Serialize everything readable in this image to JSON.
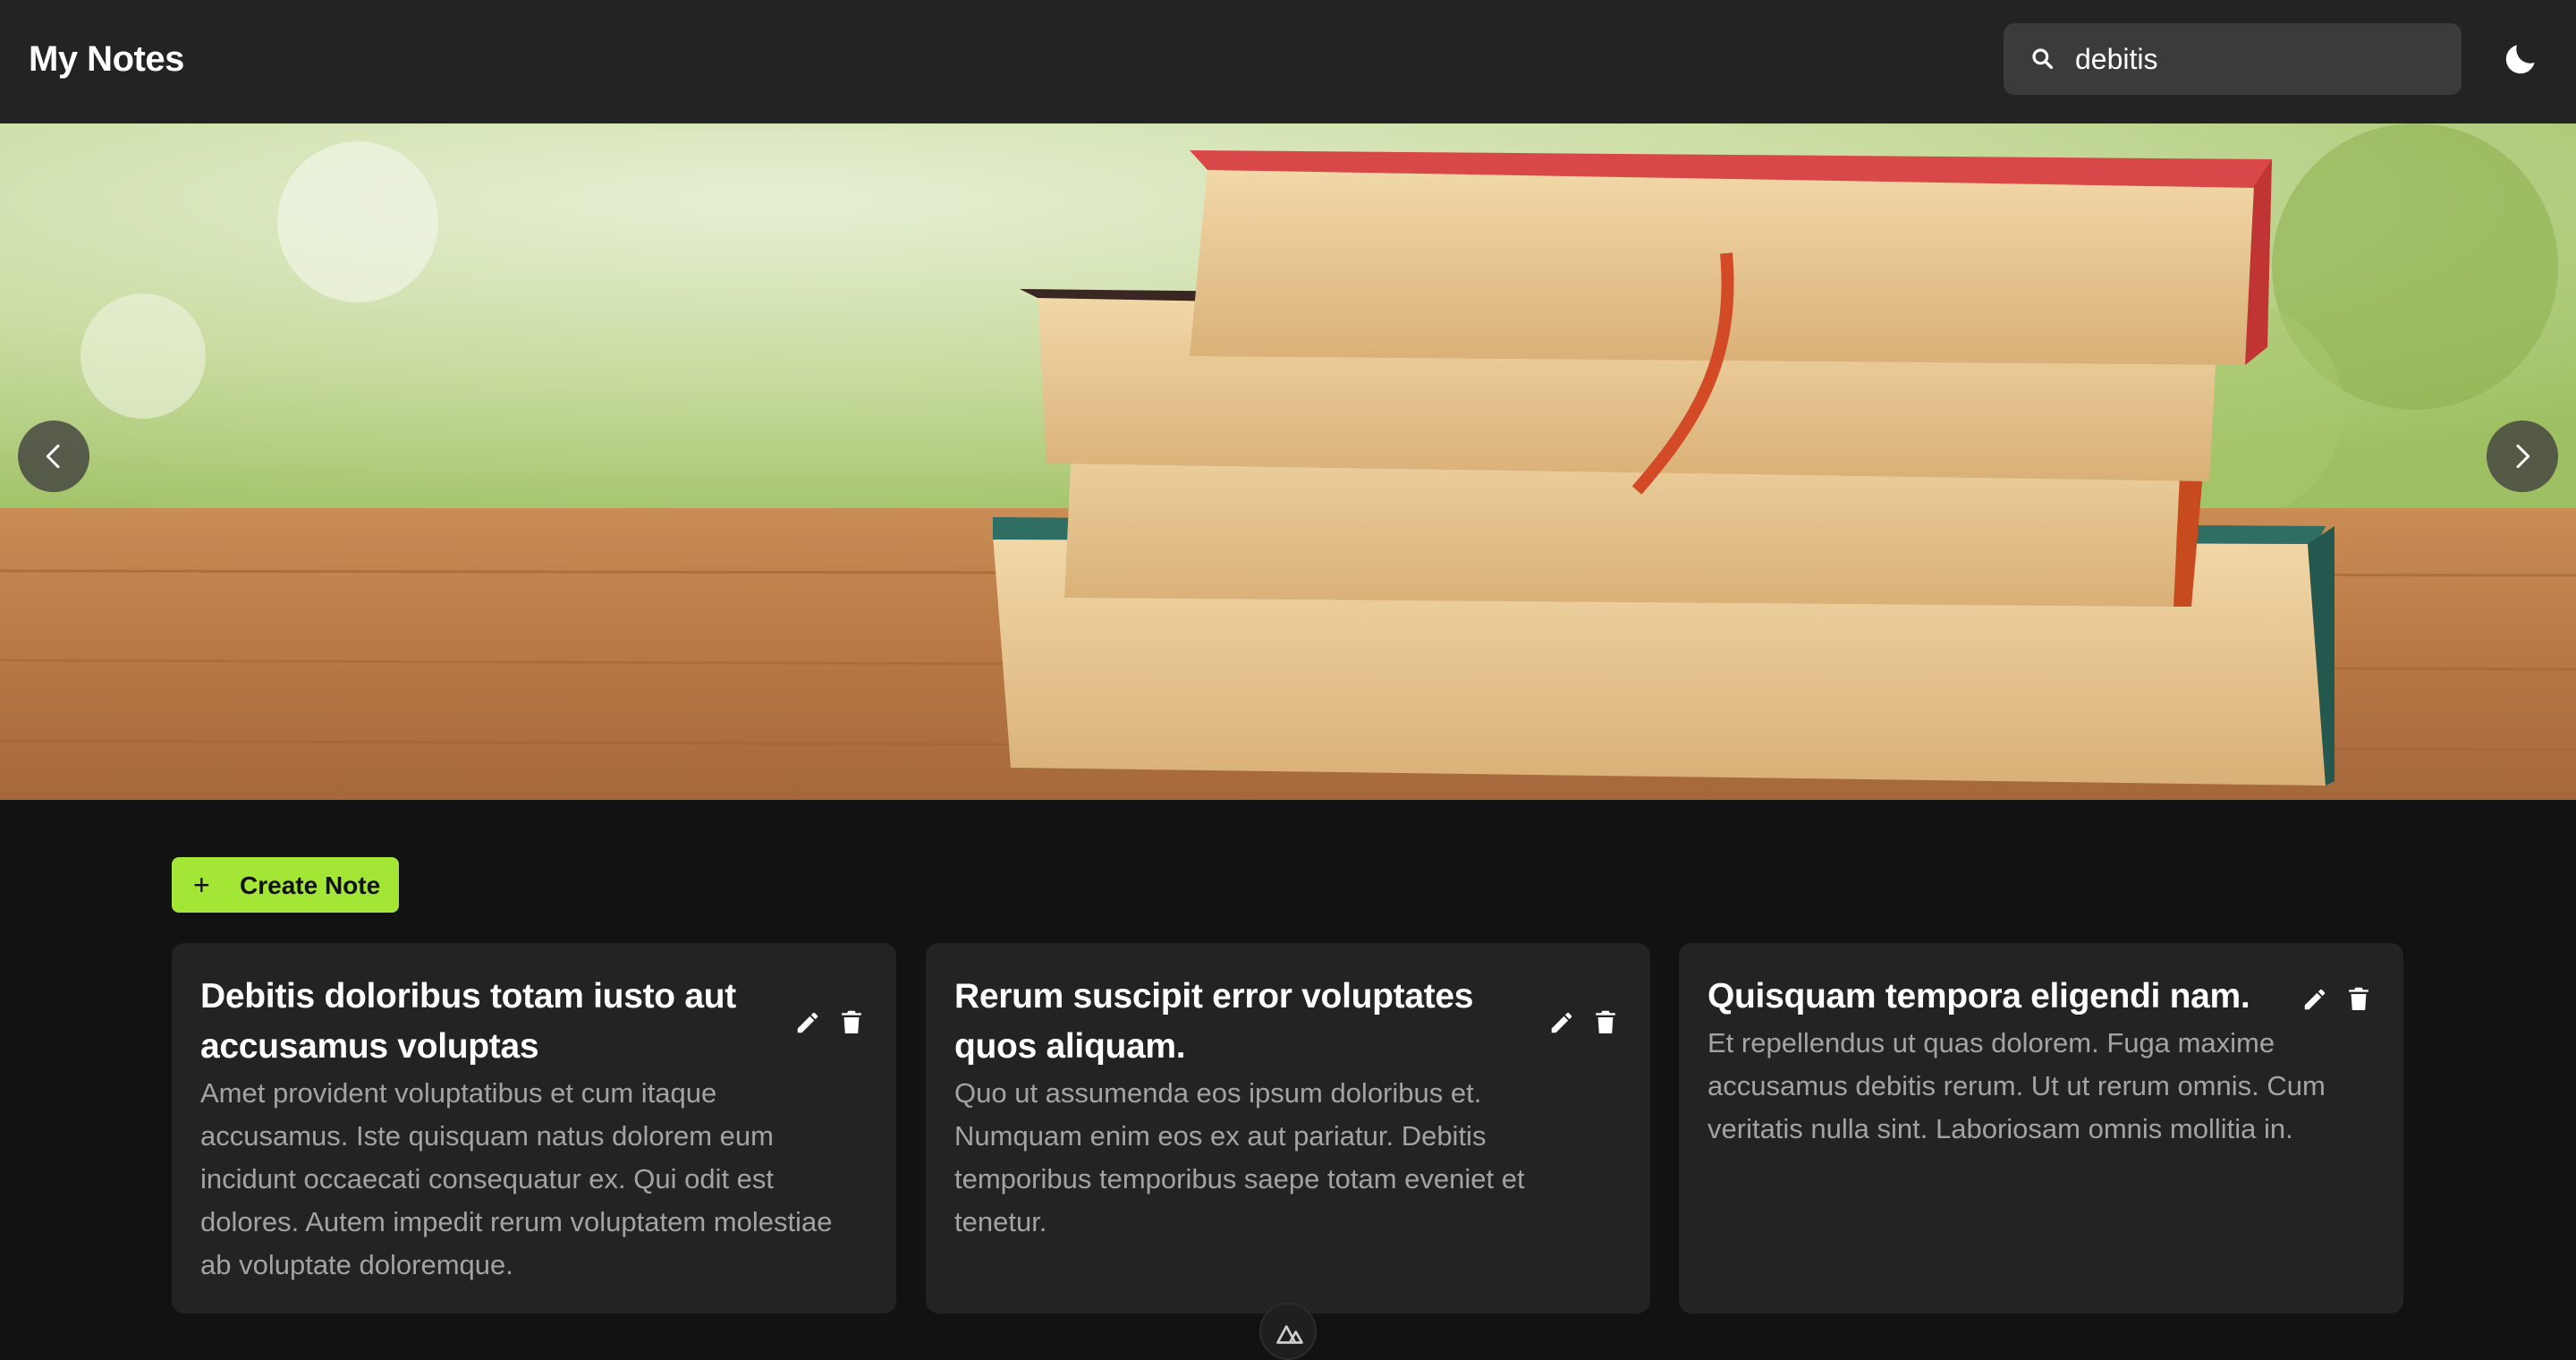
{
  "header": {
    "title": "My Notes",
    "search_value": "debitis",
    "search_icon": "search-icon",
    "theme_icon": "moon-icon"
  },
  "carousel": {
    "prev_icon": "chevron-left-icon",
    "next_icon": "chevron-right-icon"
  },
  "actions": {
    "create_note_icon": "plus-icon",
    "create_note_label": "Create Note",
    "accent_color": "#a3e635"
  },
  "notes": [
    {
      "title": "Debitis doloribus totam iusto aut accusamus voluptas",
      "body": "Amet provident voluptatibus et cum itaque accusamus. Iste quisquam natus dolorem eum incidunt occaecati consequatur ex. Qui odit est dolores. Autem impedit rerum voluptatem molestiae ab voluptate doloremque."
    },
    {
      "title": "Rerum suscipit error voluptates quos aliquam.",
      "body": "Quo ut assumenda eos ipsum doloribus et. Numquam enim eos ex aut pariatur. Debitis temporibus temporibus saepe totam eveniet et tenetur."
    },
    {
      "title": "Quisquam tempora eligendi nam.",
      "body": "Et repellendus ut quas dolorem. Fuga maxime accusamus debitis rerum. Ut ut rerum omnis. Cum veritatis nulla sint. Laboriosam omnis mollitia in."
    }
  ],
  "colors": {
    "header_bg": "#232323",
    "page_bg": "#121212",
    "card_bg": "#232323",
    "muted_text": "#a3a3a3"
  }
}
